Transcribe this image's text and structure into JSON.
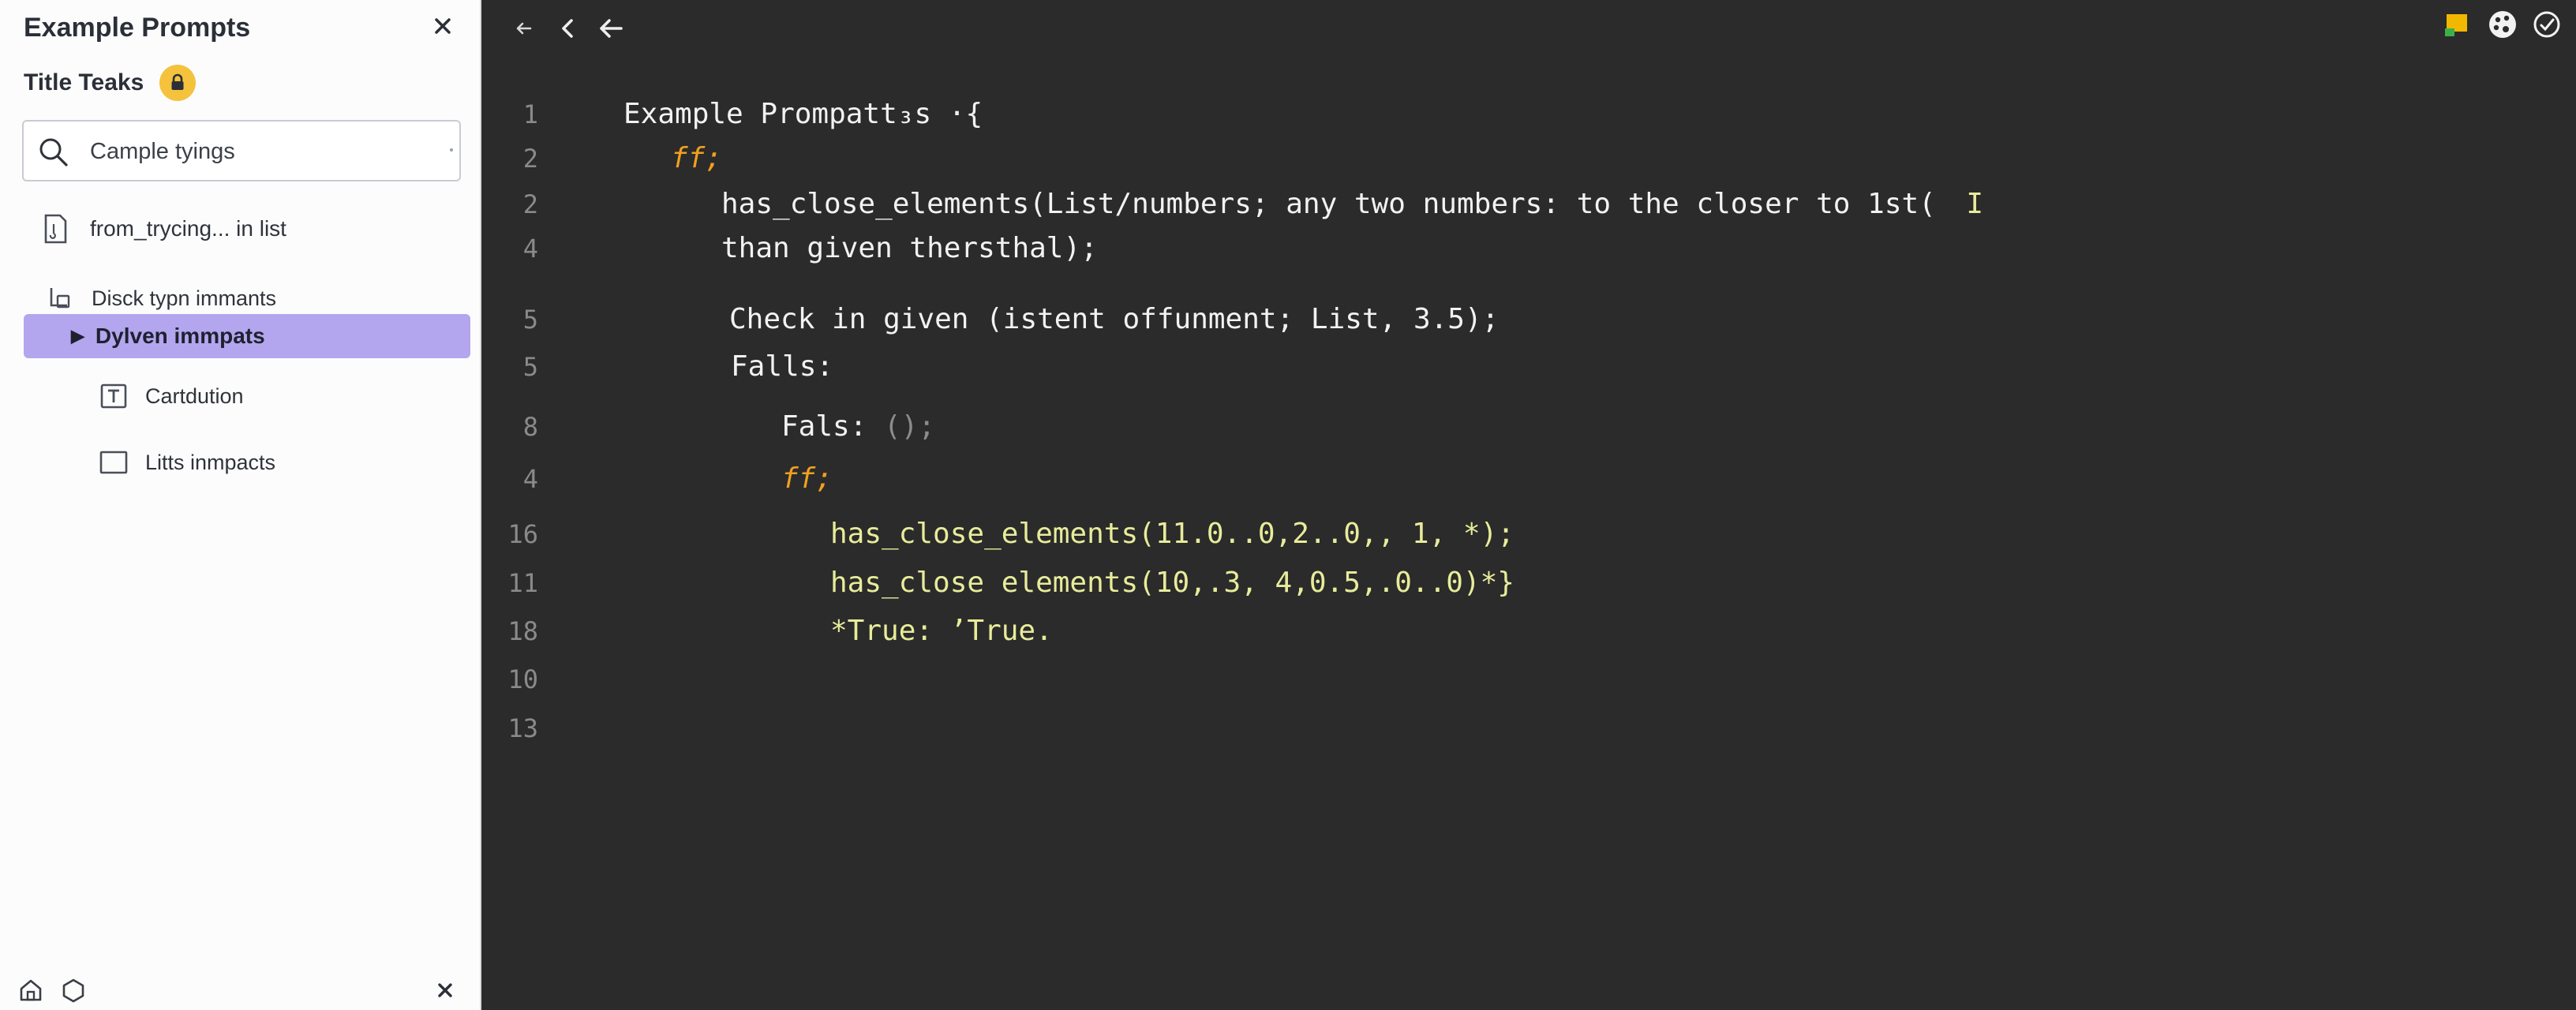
{
  "sidebar": {
    "title": "Example Prompts",
    "subtitle": "Title Teaks",
    "search": {
      "placeholder": "Cample tyings"
    },
    "items": [
      {
        "label": "from_trycing... in list",
        "icon": "file-icon"
      },
      {
        "label": "Disck typn immants",
        "icon": "folder-branch-icon"
      },
      {
        "label": "Dylven immpats",
        "icon": "caret-right-icon",
        "selected": true
      },
      {
        "label": "Cartdution",
        "icon": "text-box-icon"
      },
      {
        "label": "Litts inmpacts",
        "icon": "square-icon"
      }
    ]
  },
  "editor": {
    "lines": [
      {
        "num": "1",
        "segments": [
          {
            "text": "Example Prompatt₃s ·{",
            "style": "white"
          }
        ]
      },
      {
        "num": "2",
        "segments": [
          {
            "text": "ff;",
            "style": "kw"
          }
        ]
      },
      {
        "num": "2",
        "segments": [
          {
            "text": "has_close_elements(List/numbers; any two numbers: to the closer to 1st(",
            "style": "white"
          },
          {
            "text": "  I",
            "style": "yellow"
          }
        ]
      },
      {
        "num": "4",
        "segments": [
          {
            "text": "than given thersthal);",
            "style": "white"
          }
        ]
      },
      {
        "num": "5",
        "segments": [
          {
            "text": "Check in given (istent offunment; List, 3.5);",
            "style": "white"
          }
        ]
      },
      {
        "num": "5",
        "segments": [
          {
            "text": "Falls:",
            "style": "white"
          }
        ]
      },
      {
        "num": "8",
        "segments": [
          {
            "text": "Fals: ",
            "style": "white"
          },
          {
            "text": "();",
            "style": "gray"
          }
        ]
      },
      {
        "num": "4",
        "segments": [
          {
            "text": "ff;",
            "style": "kw"
          }
        ]
      },
      {
        "num": "16",
        "segments": [
          {
            "text": "has_close_elements(11.0..0,2..0,, 1, *);",
            "style": "yellow"
          }
        ]
      },
      {
        "num": "11",
        "segments": [
          {
            "text": "has_close elements(10,.3, 4,0.5,.0..0)*}",
            "style": "yellow"
          }
        ]
      },
      {
        "num": "18",
        "segments": [
          {
            "text": "*True: ’True.",
            "style": "yellow"
          }
        ]
      },
      {
        "num": "10",
        "segments": []
      },
      {
        "num": "13",
        "segments": []
      }
    ]
  },
  "colors": {
    "editor_bg": "#2b2b2b",
    "sidebar_bg": "#fcfcfd",
    "selected_bg": "#b3a6ee",
    "keyword": "#f0a020",
    "string_yellow": "#e8ec9a",
    "lock_badge": "#f4c23c"
  }
}
